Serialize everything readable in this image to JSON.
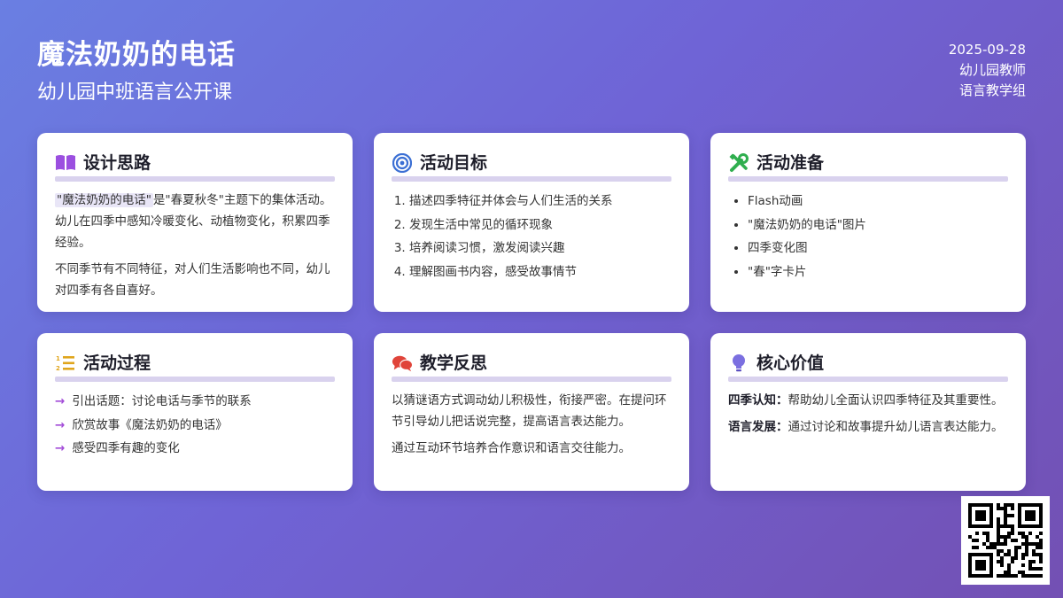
{
  "header": {
    "title": "魔法奶奶的电话",
    "subtitle": "幼儿园中班语言公开课",
    "date": "2025-09-28",
    "author": "幼儿园教师",
    "group": "语言教学组"
  },
  "cards": {
    "design": {
      "title": "设计思路",
      "icon": "book-icon",
      "highlight": "\"魔法奶奶的电话\"",
      "p1_rest": "是\"春夏秋冬\"主题下的集体活动。幼儿在四季中感知冷暖变化、动植物变化，积累四季经验。",
      "p2": "不同季节有不同特征，对人们生活影响也不同，幼儿对四季有各自喜好。"
    },
    "goals": {
      "title": "活动目标",
      "icon": "target-icon",
      "items": [
        "描述四季特征并体会与人们生活的关系",
        "发现生活中常见的循环现象",
        "培养阅读习惯，激发阅读兴趣",
        "理解图画书内容，感受故事情节"
      ]
    },
    "prep": {
      "title": "活动准备",
      "icon": "tools-icon",
      "items": [
        "Flash动画",
        "\"魔法奶奶的电话\"图片",
        "四季变化图",
        "\"春\"字卡片"
      ]
    },
    "process": {
      "title": "活动过程",
      "icon": "numbered-list-icon",
      "items": [
        "引出话题：讨论电话与季节的联系",
        "欣赏故事《魔法奶奶的电话》",
        "感受四季有趣的变化"
      ]
    },
    "reflection": {
      "title": "教学反思",
      "icon": "chat-bubbles-icon",
      "p1": "以猜谜语方式调动幼儿积极性，衔接严密。在提问环节引导幼儿把话说完整，提高语言表达能力。",
      "p2": "通过互动环节培养合作意识和语言交往能力。"
    },
    "value": {
      "title": "核心价值",
      "icon": "lightbulb-icon",
      "k1": "四季认知：",
      "v1": "帮助幼儿全面认识四季特征及其重要性。",
      "k2": "语言发展：",
      "v2": "通过讨论和故事提升幼儿语言表达能力。"
    }
  },
  "qr": {
    "icon": "qr-code-icon"
  },
  "colors": {
    "bg_start": "#6a7fe2",
    "bg_end": "#7350b3",
    "accent_purple": "#a34cd8",
    "target_blue": "#3b6fd4",
    "tools_green": "#2fae4e",
    "list_yellow": "#e0a51c",
    "chat_red": "#e0443a",
    "bulb_purple": "#7b6fe0"
  }
}
